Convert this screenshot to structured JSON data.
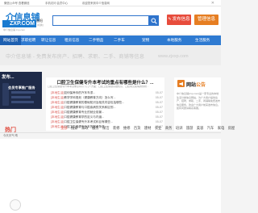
{
  "topbar": {
    "t1": "微信公众号 查看微信",
    "t2": "手机访问 会员中心",
    "t3": "欢迎您来到中介信息网",
    "close": "✕"
  },
  "logo": {
    "top": "介信息铺",
    "bottom": "ZXP.COM",
    "sub": "中介信息铺 zxp.com"
  },
  "header": {
    "region": "晋阳",
    "region_sub": "[切换]",
    "search_placeholder": "",
    "publish_label": "发布信息",
    "manage_label": "管理信息"
  },
  "nav": {
    "items": [
      "网站首页",
      "求职招聘",
      "转让信息",
      "租房信息",
      "二手物品",
      "二手车",
      "宠物",
      "本地服务",
      "生活服务"
    ],
    "active_index": 0
  },
  "banner": {
    "slogan": "中介信息铺 - 免费发布房产、招聘、求职、二手、商铺等信息",
    "url": "www.zjxxp.com"
  },
  "promo": {
    "title": "发布...",
    "subtitle": "会员专享推广服务"
  },
  "news": {
    "headline": "口腔卫生保健专升本考试的重点有哪些是什么？...",
    "summary": "口腔卫生保健专升本考试重点有以下几个方面：口腔卫生保健基础知识、口腔常见疾病的预防...",
    "items": [
      {
        "tag": "[本地生活]",
        "title": "如何保养你的汽车车漆...",
        "date": "05-07"
      },
      {
        "tag": "[本地生活]",
        "title": "教学学科规划（健康教育方向）怎么写...",
        "date": "05-07"
      },
      {
        "tag": "[本地生活]",
        "title": "口腔健康教育的基础知识及相关内容包括哪些...",
        "date": "05-07"
      },
      {
        "tag": "[本地生活]",
        "title": "口腔健康教育与口腔疾病的关系和区别...",
        "date": "05-07"
      },
      {
        "tag": "[本地生活]",
        "title": "口腔健康教育专业的就业前景...",
        "date": "05-07"
      },
      {
        "tag": "[本地生活]",
        "title": "口腔健康教育学的定义与内涵...",
        "date": "05-07"
      },
      {
        "tag": "[本地生活]",
        "title": "口腔卫生保健专升本考试科目有哪些...",
        "date": "05-07"
      },
      {
        "tag": "[本地生活]",
        "title": "口腔卫生保健专升本的报考条件...",
        "date": "05-07"
      }
    ]
  },
  "notice": {
    "title_a": "网站",
    "title_b": "公告",
    "body": "中介信息铺(zxp.com)是一家专业的本地生活分类信息网站，为广大用户提供房产、招聘、求职、二手、商铺等免费发布信息服务，欢迎广大用户前来发布信息。如有问题请联系客服。"
  },
  "weather": "今天天气 晴",
  "categories": {
    "label": "热门",
    "items": [
      "全部",
      "搜索",
      "家政",
      "服务",
      "保洁",
      "装修",
      "维修",
      "百货",
      "建材",
      "农业",
      "商务",
      "培训",
      "旅游",
      "美容",
      "汽车",
      "家电",
      "房屋"
    ],
    "active_index": 0
  },
  "colors": {
    "brand": "#1a7bd0",
    "nav": "#2e7ad1",
    "publish": "#e74c3c",
    "manage": "#e67e22",
    "tag": "#d9534f"
  }
}
